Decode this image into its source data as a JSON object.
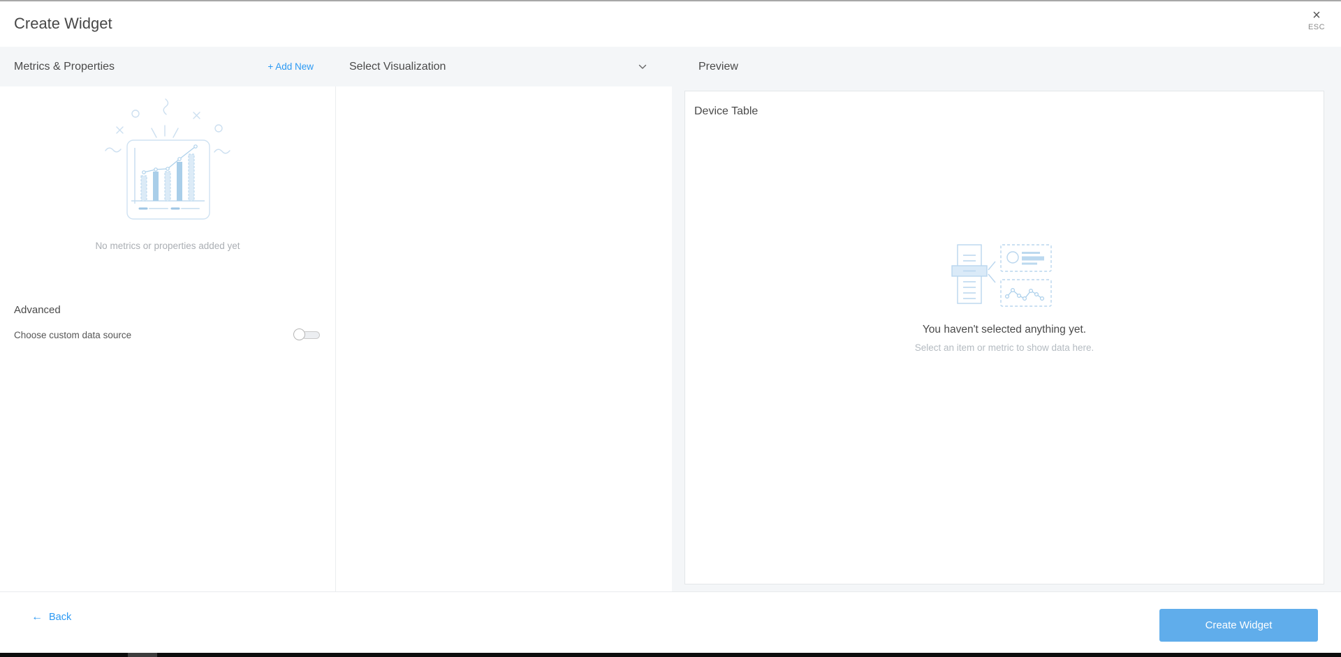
{
  "header": {
    "title": "Create Widget",
    "close_glyph": "×",
    "esc_label": "ESC"
  },
  "columns": {
    "metrics": {
      "title": "Metrics & Properties",
      "add_new_label": "+ Add New",
      "empty_text": "No metrics or properties added yet",
      "advanced_label": "Advanced",
      "custom_source_label": "Choose custom data source",
      "custom_source_toggle": "off"
    },
    "visualization": {
      "title": "Select Visualization"
    },
    "preview": {
      "title": "Preview",
      "widget_title": "Device Table",
      "empty_title": "You haven't selected anything yet.",
      "empty_subtitle": "Select an item or metric to show data here."
    }
  },
  "footer": {
    "back_arrow": "←",
    "back_label": "Back",
    "create_label": "Create Widget"
  },
  "colors": {
    "accent_blue": "#2b99f3",
    "button_blue": "#60adeb",
    "header_row_bg": "#f4f6f8",
    "illustration_blue": "#bcd8ee"
  }
}
